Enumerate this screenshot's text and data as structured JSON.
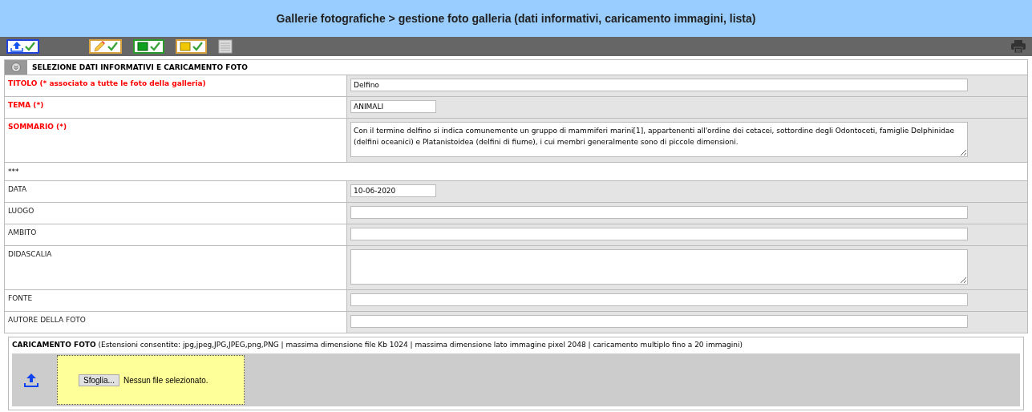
{
  "header": {
    "title": "Gallerie fotografiche > gestione foto galleria (dati informativi, caricamento immagini, lista)"
  },
  "toolbar": {
    "buttons": [
      {
        "kind": "upload"
      },
      {
        "kind": "edit"
      },
      {
        "kind": "green"
      },
      {
        "kind": "yellow"
      },
      {
        "kind": "list"
      }
    ]
  },
  "section": {
    "title": "SELEZIONE DATI INFORMATIVI E CARICAMENTO FOTO"
  },
  "rows": [
    {
      "kind": "text",
      "label": "TITOLO (* associato a tutte le foto della galleria)",
      "required": true,
      "value": "Delfino"
    },
    {
      "kind": "short",
      "label": "TEMA (*)",
      "required": true,
      "value": "ANIMALI"
    },
    {
      "kind": "textarea",
      "label": "SOMMARIO (*)",
      "required": true,
      "value": "Con il termine delfino si indica comunemente un gruppo di mammiferi marini[1], appartenenti all'ordine dei cetacei, sottordine degli Odontoceti, famiglie Delphinidae (delfini oceanici) e Platanistoidea (delfini di fiume), i cui membri generalmente sono di piccole dimensioni."
    },
    {
      "kind": "separator",
      "label": "***"
    },
    {
      "kind": "short",
      "label": "DATA",
      "required": false,
      "value": "10-06-2020"
    },
    {
      "kind": "text",
      "label": "LUOGO",
      "required": false
    },
    {
      "kind": "text",
      "label": "AMBITO",
      "required": false
    },
    {
      "kind": "textarea",
      "label": "DIDASCALIA",
      "required": false
    },
    {
      "kind": "text",
      "label": "FONTE",
      "required": false
    },
    {
      "kind": "text",
      "label": "AUTORE DELLA FOTO",
      "required": false
    }
  ],
  "upload": {
    "title": "CARICAMENTO FOTO",
    "note": "(Estensioni consentite: jpg,jpeg,JPG,JPEG,png,PNG | massima dimensione file Kb 1024 | massima dimensione lato immagine pixel 2048 | caricamento multiplo fino a 20 immagini)",
    "button": "Sfoglia...",
    "status": "Nessun file selezionato."
  }
}
